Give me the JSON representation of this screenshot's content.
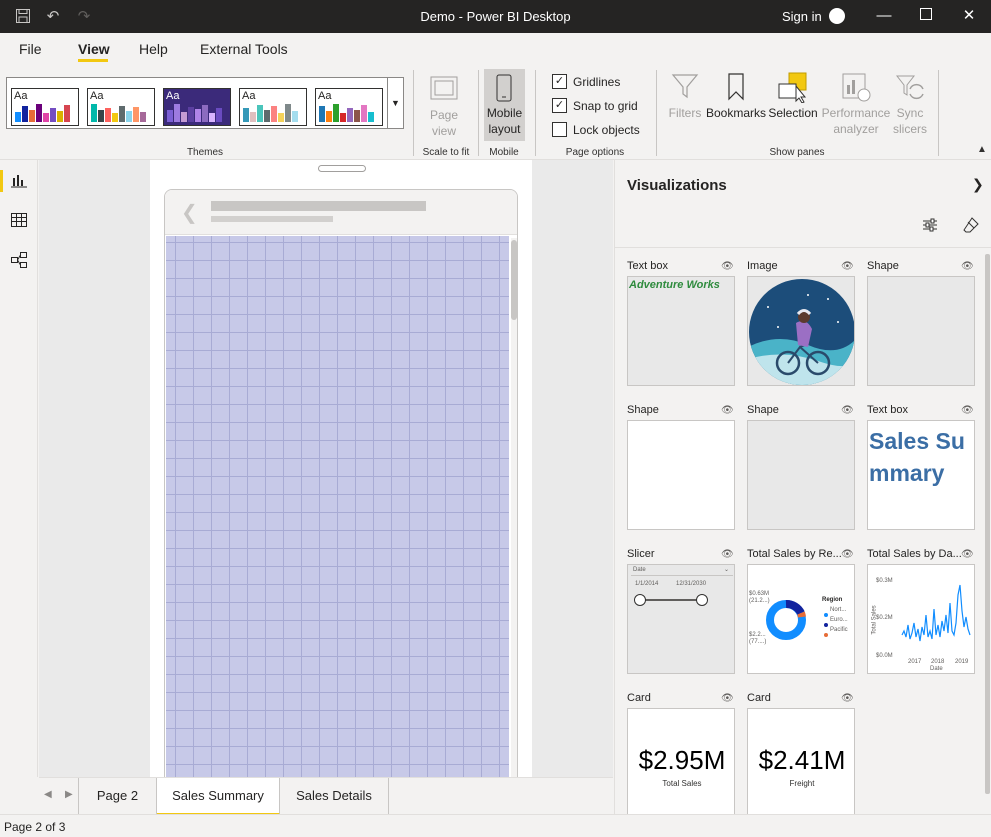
{
  "titlebar": {
    "title": "Demo - Power BI Desktop",
    "sign_in": "Sign in",
    "save_icon": "save-icon",
    "undo_icon": "undo-icon",
    "redo_icon": "redo-icon",
    "minimize": "—",
    "maximize": "☐",
    "close": "✕"
  },
  "menu": {
    "file": "File",
    "view": "View",
    "help": "Help",
    "external_tools": "External Tools"
  },
  "ribbon": {
    "themes_label": "Themes",
    "theme_aa": "Aa",
    "page_view": "Page view",
    "scale_to_fit": "Scale to fit",
    "mobile_layout_1": "Mobile",
    "mobile_layout_2": "layout",
    "mobile_group": "Mobile",
    "gridlines": "Gridlines",
    "snap_to_grid": "Snap to grid",
    "lock_objects": "Lock objects",
    "page_options": "Page options",
    "filters": "Filters",
    "bookmarks": "Bookmarks",
    "selection": "Selection",
    "performance_1": "Performance",
    "performance_2": "analyzer",
    "sync_1": "Sync",
    "sync_2": "slicers",
    "show_panes": "Show panes",
    "gridlines_checked": true,
    "snap_checked": true,
    "lock_checked": false
  },
  "tabs": {
    "items": [
      "Page 2",
      "Sales Summary",
      "Sales Details"
    ],
    "active": "Sales Summary"
  },
  "status": {
    "page_info": "Page 2 of 3"
  },
  "visualizations": {
    "title": "Visualizations",
    "cards": [
      {
        "title": "Text box",
        "content": "Adventure Works"
      },
      {
        "title": "Image"
      },
      {
        "title": "Shape"
      },
      {
        "title": "Shape"
      },
      {
        "title": "Shape"
      },
      {
        "title": "Text box",
        "content": "Sales Summary"
      },
      {
        "title": "Slicer",
        "field": "Date",
        "start": "1/1/2014",
        "end": "12/31/2030"
      },
      {
        "title": "Total Sales by Re...",
        "legend_title": "Region",
        "legend": [
          "Nort...",
          "Euro...",
          "Pacific"
        ],
        "label_top": "$0.63M",
        "label_top2": "(21.2...)",
        "label_bot": "$2.2...",
        "label_bot2": "(77....)"
      },
      {
        "title": "Total Sales by Da...",
        "y_ticks": [
          "$0.3M",
          "$0.2M",
          "$0.0M"
        ],
        "x_ticks": [
          "2017",
          "2018",
          "2019"
        ],
        "xlabel": "Date",
        "ylabel": "Total Sales"
      },
      {
        "title": "Card",
        "value": "$2.95M",
        "label": "Total Sales"
      },
      {
        "title": "Card",
        "value": "$2.41M",
        "label": "Freight"
      }
    ]
  },
  "colors": {
    "accent": "#f2c811",
    "grid": "#c7c9e8",
    "titlebar": "#252423",
    "donut_north": "#118dff",
    "donut_europe": "#12239e",
    "donut_pacific": "#e66c37"
  }
}
